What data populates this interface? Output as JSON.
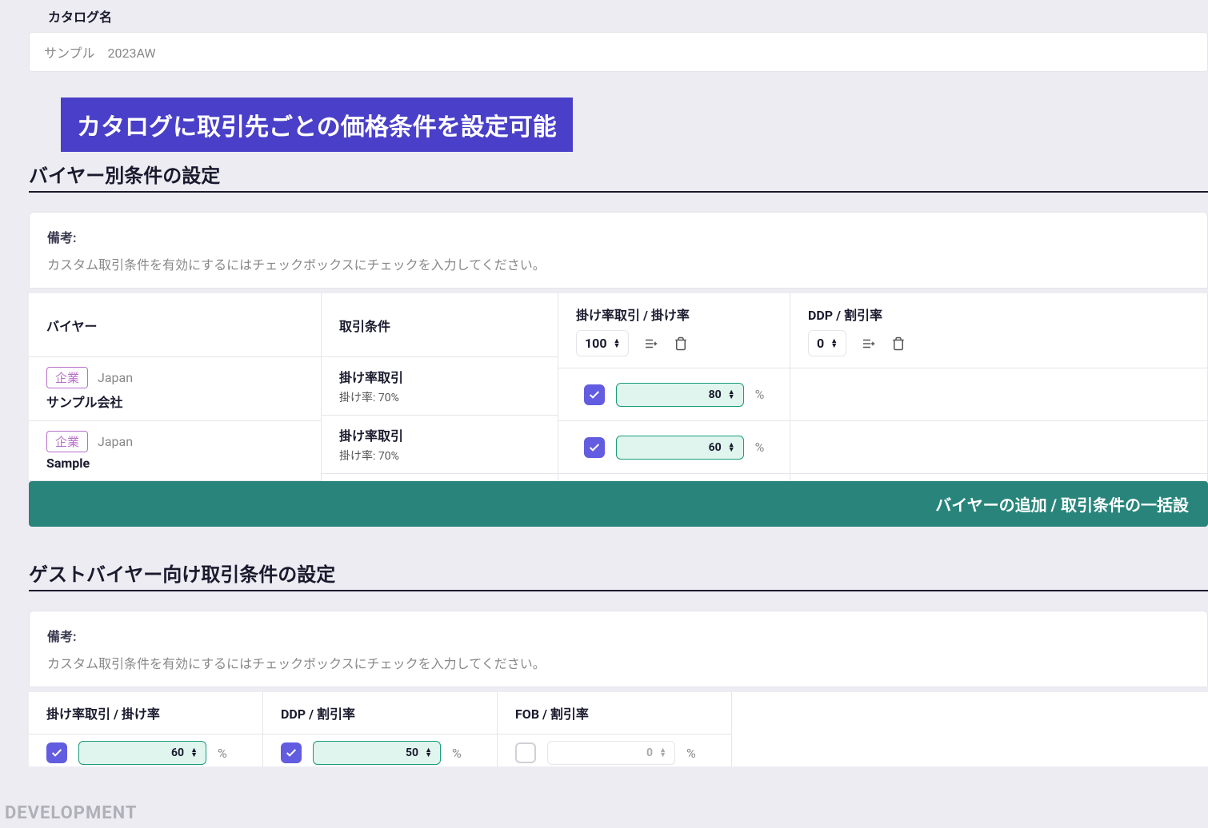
{
  "catalog": {
    "label": "カタログ名",
    "value": "サンプル　2023AW"
  },
  "banner": "カタログに取引先ごとの価格条件を設定可能",
  "sections": {
    "buyer": {
      "title": "バイヤー別条件の設定",
      "remark_label": "備考:",
      "remark_text": "カスタム取引条件を有効にするにはチェックボックスにチェックを入力してください。"
    },
    "guest": {
      "title": "ゲストバイヤー向け取引条件の設定",
      "remark_label": "備考:",
      "remark_text": "カスタム取引条件を有効にするにはチェックボックスにチェックを入力してください。"
    }
  },
  "buyer_table": {
    "headers": {
      "buyer": "バイヤー",
      "trade": "取引条件",
      "rate": "掛け率取引 / 掛け率",
      "rate_default": "100",
      "ddp": "DDP / 割引率",
      "ddp_default": "0"
    },
    "rows": [
      {
        "badge": "企業",
        "country": "Japan",
        "name": "サンプル会社",
        "trade_type": "掛け率取引",
        "rate_text": "掛け率: 70%",
        "rate_checked": true,
        "rate_value": "80"
      },
      {
        "badge": "企業",
        "country": "Japan",
        "name": "Sample",
        "trade_type": "掛け率取引",
        "rate_text": "掛け率: 70%",
        "rate_checked": true,
        "rate_value": "60"
      }
    ],
    "action": "バイヤーの追加 / 取引条件の一括設"
  },
  "guest_table": {
    "cols": [
      {
        "label": "掛け率取引 / 掛け率",
        "checked": true,
        "value": "60"
      },
      {
        "label": "DDP / 割引率",
        "checked": true,
        "value": "50"
      },
      {
        "label": "FOB / 割引率",
        "checked": false,
        "value": "0"
      }
    ]
  },
  "pct_symbol": "%",
  "watermark": "DEVELOPMENT"
}
